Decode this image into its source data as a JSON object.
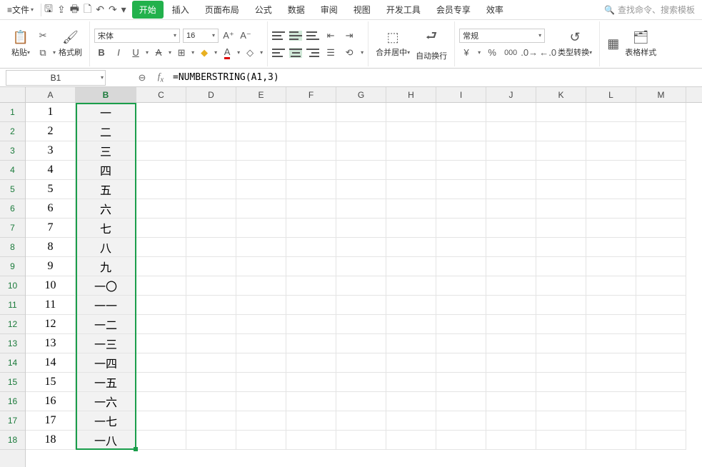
{
  "menu": {
    "file_label": "文件",
    "qat_tips": [
      "save",
      "share",
      "print",
      "preview",
      "undo",
      "redo"
    ],
    "tabs": [
      "开始",
      "插入",
      "页面布局",
      "公式",
      "数据",
      "审阅",
      "视图",
      "开发工具",
      "会员专享",
      "效率"
    ],
    "active_tab_index": 0,
    "search_placeholder": "查找命令、搜索模板"
  },
  "ribbon": {
    "paste_label": "粘贴",
    "format_painter_label": "格式刷",
    "font_name": "宋体",
    "font_size": "16",
    "merge_center_label": "合并居中",
    "wrap_text_label": "自动换行",
    "number_format": "常规",
    "type_convert_label": "类型转换",
    "table_style_label": "表格样式"
  },
  "formula_bar": {
    "cell_ref": "B1",
    "formula": "=NUMBERSTRING(A1,3)"
  },
  "sheet": {
    "columns": [
      "A",
      "B",
      "C",
      "D",
      "E",
      "F",
      "G",
      "H",
      "I",
      "J",
      "K",
      "L",
      "M"
    ],
    "col_widths": {
      "A": 70,
      "B": 85
    },
    "default_col_width": 70,
    "visible_rows": 18,
    "selected_range": "B1:B18",
    "active_cell": "B1",
    "data": [
      {
        "A": "1",
        "B": "一"
      },
      {
        "A": "2",
        "B": "二"
      },
      {
        "A": "3",
        "B": "三"
      },
      {
        "A": "4",
        "B": "四"
      },
      {
        "A": "5",
        "B": "五"
      },
      {
        "A": "6",
        "B": "六"
      },
      {
        "A": "7",
        "B": "七"
      },
      {
        "A": "8",
        "B": "八"
      },
      {
        "A": "9",
        "B": "九"
      },
      {
        "A": "10",
        "B": "一〇"
      },
      {
        "A": "11",
        "B": "一一"
      },
      {
        "A": "12",
        "B": "一二"
      },
      {
        "A": "13",
        "B": "一三"
      },
      {
        "A": "14",
        "B": "一四"
      },
      {
        "A": "15",
        "B": "一五"
      },
      {
        "A": "16",
        "B": "一六"
      },
      {
        "A": "17",
        "B": "一七"
      },
      {
        "A": "18",
        "B": "一八"
      }
    ]
  }
}
